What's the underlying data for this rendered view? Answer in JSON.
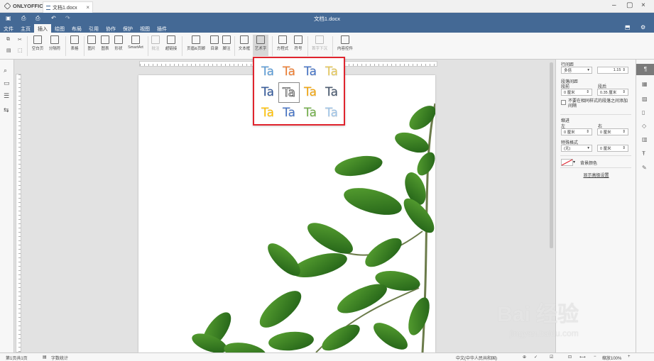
{
  "app": {
    "brand": "ONLYOFFICE"
  },
  "tab": {
    "title": "文档1.docx"
  },
  "doc_title": "文档1.docx",
  "menu": [
    "文件",
    "主页",
    "插入",
    "绘图",
    "布局",
    "引用",
    "协作",
    "保护",
    "视图",
    "插件"
  ],
  "toolbar": {
    "blank_page": "空白页",
    "page_break": "分隔符",
    "table": "表格",
    "image": "图片",
    "chart": "图表",
    "shape": "形状",
    "smartart": "SmartArt",
    "comment": "批注",
    "hyperlink": "超链接",
    "header_footer": "页眉&页脚",
    "toc": "目录",
    "footnote": "脚注",
    "textbox": "文本框",
    "text_art": "艺术字",
    "equation": "方程式",
    "symbol": "符号",
    "dropcap": "首字下沉",
    "content_control": "内容控件"
  },
  "text_art": {
    "styles": [
      {
        "text": "Ta",
        "color": "#5b9bd5"
      },
      {
        "text": "Ta",
        "color": "#ed7d31"
      },
      {
        "text": "Ta",
        "color": "#4472c4"
      },
      {
        "text": "Ta",
        "color": "#e4c75a"
      },
      {
        "text": "Ta",
        "color": "#2f5597"
      },
      {
        "text": "Ta",
        "color": "#fbfbfb"
      },
      {
        "text": "Ta",
        "color": "#f0a30a"
      },
      {
        "text": "Ta",
        "color": "#44546a"
      },
      {
        "text": "Ta",
        "color": "#ffc000"
      },
      {
        "text": "Ta",
        "color": "#4472c4"
      },
      {
        "text": "Ta",
        "color": "#70ad47"
      },
      {
        "text": "Ta",
        "color": "#9dc3e6"
      }
    ]
  },
  "right_panel": {
    "line_spacing_title": "行间距",
    "line_spacing_mode": "多倍",
    "line_spacing_value": "1.15",
    "paragraph_spacing_title": "段落间距",
    "before_label": "段前",
    "after_label": "段后",
    "before_value": "0 厘米",
    "after_value": "0.35 厘米",
    "no_space_label": "不要在相同样式的段落之间添加间隔",
    "indent_title": "缩进",
    "left_label": "左",
    "right_label": "右",
    "left_value": "0 厘米",
    "right_value": "0 厘米",
    "special_label": "特殊格式",
    "special_value": "(无)",
    "special_amount": "0 厘米",
    "bg_color_label": "背景颜色",
    "advanced_link": "显示高级设置"
  },
  "status": {
    "page": "第1页共1页",
    "word_count": "字数统计",
    "language": "中文(中华人民共和国)",
    "zoom": "缩放100%"
  },
  "watermark": {
    "line1": "Bai 经验",
    "line2": "jingyan.baidu.com"
  }
}
